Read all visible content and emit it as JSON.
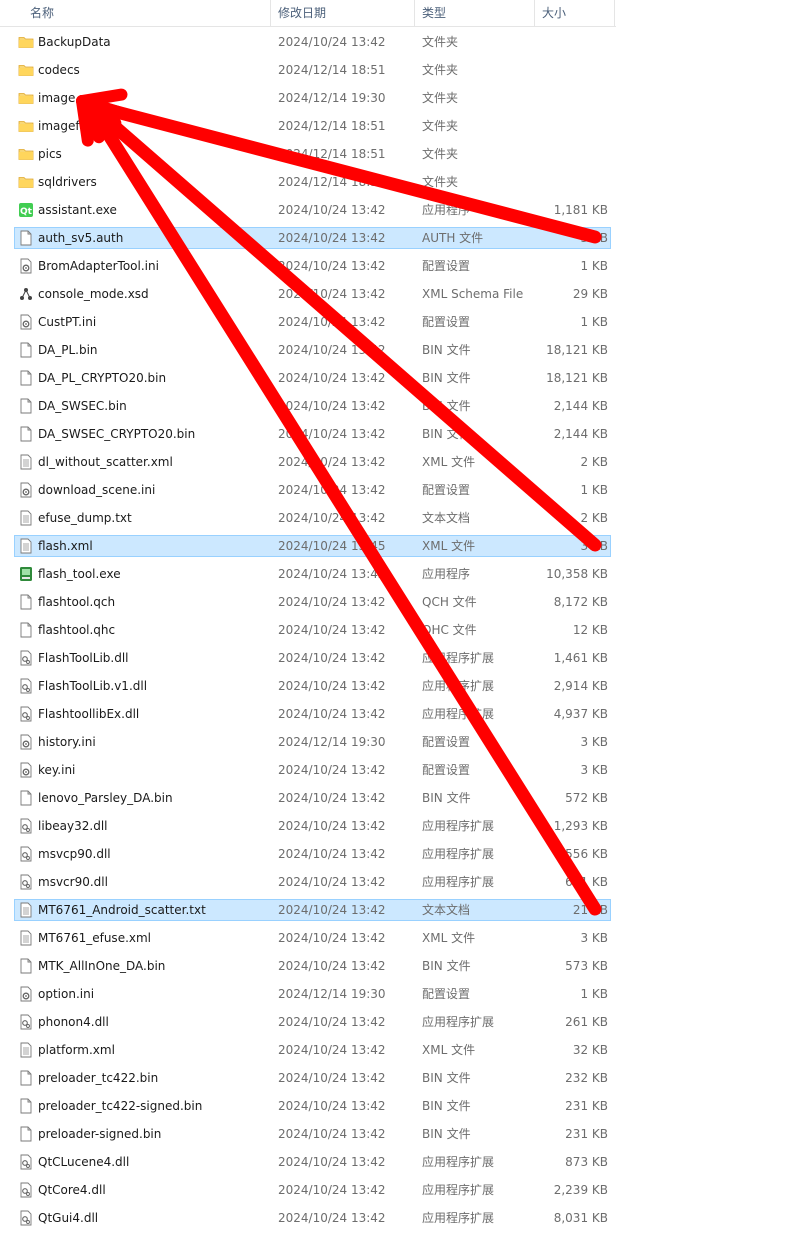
{
  "header": {
    "col_name": "名称",
    "col_date": "修改日期",
    "col_type": "类型",
    "col_size": "大小"
  },
  "rows": [
    {
      "name": "BackupData",
      "date": "2024/10/24 13:42",
      "type": "文件夹",
      "size": "",
      "icon": "folder-icon",
      "sel": false
    },
    {
      "name": "codecs",
      "date": "2024/12/14 18:51",
      "type": "文件夹",
      "size": "",
      "icon": "folder-icon",
      "sel": false
    },
    {
      "name": "image",
      "date": "2024/12/14 19:30",
      "type": "文件夹",
      "size": "",
      "icon": "folder-icon",
      "sel": false
    },
    {
      "name": "imageformats",
      "date": "2024/12/14 18:51",
      "type": "文件夹",
      "size": "",
      "icon": "folder-icon",
      "sel": false
    },
    {
      "name": "pics",
      "date": "2024/12/14 18:51",
      "type": "文件夹",
      "size": "",
      "icon": "folder-icon",
      "sel": false
    },
    {
      "name": "sqldrivers",
      "date": "2024/12/14 18:51",
      "type": "文件夹",
      "size": "",
      "icon": "folder-icon",
      "sel": false
    },
    {
      "name": "assistant.exe",
      "date": "2024/10/24 13:42",
      "type": "应用程序",
      "size": "1,181 KB",
      "icon": "qt-exe-icon",
      "sel": false
    },
    {
      "name": "auth_sv5.auth",
      "date": "2024/10/24 13:42",
      "type": "AUTH 文件",
      "size": "3 KB",
      "icon": "file-icon",
      "sel": true
    },
    {
      "name": "BromAdapterTool.ini",
      "date": "2024/10/24 13:42",
      "type": "配置设置",
      "size": "1 KB",
      "icon": "settings-file-icon",
      "sel": false
    },
    {
      "name": "console_mode.xsd",
      "date": "2024/10/24 13:42",
      "type": "XML Schema File",
      "size": "29 KB",
      "icon": "xsd-icon",
      "sel": false
    },
    {
      "name": "CustPT.ini",
      "date": "2024/10/24 13:42",
      "type": "配置设置",
      "size": "1 KB",
      "icon": "settings-file-icon",
      "sel": false
    },
    {
      "name": "DA_PL.bin",
      "date": "2024/10/24 13:42",
      "type": "BIN 文件",
      "size": "18,121 KB",
      "icon": "file-icon",
      "sel": false
    },
    {
      "name": "DA_PL_CRYPTO20.bin",
      "date": "2024/10/24 13:42",
      "type": "BIN 文件",
      "size": "18,121 KB",
      "icon": "file-icon",
      "sel": false
    },
    {
      "name": "DA_SWSEC.bin",
      "date": "2024/10/24 13:42",
      "type": "BIN 文件",
      "size": "2,144 KB",
      "icon": "file-icon",
      "sel": false
    },
    {
      "name": "DA_SWSEC_CRYPTO20.bin",
      "date": "2024/10/24 13:42",
      "type": "BIN 文件",
      "size": "2,144 KB",
      "icon": "file-icon",
      "sel": false
    },
    {
      "name": "dl_without_scatter.xml",
      "date": "2024/10/24 13:42",
      "type": "XML 文件",
      "size": "2 KB",
      "icon": "text-file-icon",
      "sel": false
    },
    {
      "name": "download_scene.ini",
      "date": "2024/10/24 13:42",
      "type": "配置设置",
      "size": "1 KB",
      "icon": "settings-file-icon",
      "sel": false
    },
    {
      "name": "efuse_dump.txt",
      "date": "2024/10/24 13:42",
      "type": "文本文档",
      "size": "2 KB",
      "icon": "text-file-icon",
      "sel": false
    },
    {
      "name": "flash.xml",
      "date": "2024/10/24 13:45",
      "type": "XML 文件",
      "size": "3 KB",
      "icon": "text-file-icon",
      "sel": true
    },
    {
      "name": "flash_tool.exe",
      "date": "2024/10/24 13:42",
      "type": "应用程序",
      "size": "10,358 KB",
      "icon": "app-exe-icon",
      "sel": false
    },
    {
      "name": "flashtool.qch",
      "date": "2024/10/24 13:42",
      "type": "QCH 文件",
      "size": "8,172 KB",
      "icon": "file-icon",
      "sel": false
    },
    {
      "name": "flashtool.qhc",
      "date": "2024/10/24 13:42",
      "type": "QHC 文件",
      "size": "12 KB",
      "icon": "file-icon",
      "sel": false
    },
    {
      "name": "FlashToolLib.dll",
      "date": "2024/10/24 13:42",
      "type": "应用程序扩展",
      "size": "1,461 KB",
      "icon": "dll-icon",
      "sel": false
    },
    {
      "name": "FlashToolLib.v1.dll",
      "date": "2024/10/24 13:42",
      "type": "应用程序扩展",
      "size": "2,914 KB",
      "icon": "dll-icon",
      "sel": false
    },
    {
      "name": "FlashtoollibEx.dll",
      "date": "2024/10/24 13:42",
      "type": "应用程序扩展",
      "size": "4,937 KB",
      "icon": "dll-icon",
      "sel": false
    },
    {
      "name": "history.ini",
      "date": "2024/12/14 19:30",
      "type": "配置设置",
      "size": "3 KB",
      "icon": "settings-file-icon",
      "sel": false
    },
    {
      "name": "key.ini",
      "date": "2024/10/24 13:42",
      "type": "配置设置",
      "size": "3 KB",
      "icon": "settings-file-icon",
      "sel": false
    },
    {
      "name": "lenovo_Parsley_DA.bin",
      "date": "2024/10/24 13:42",
      "type": "BIN 文件",
      "size": "572 KB",
      "icon": "file-icon",
      "sel": false
    },
    {
      "name": "libeay32.dll",
      "date": "2024/10/24 13:42",
      "type": "应用程序扩展",
      "size": "1,293 KB",
      "icon": "dll-icon",
      "sel": false
    },
    {
      "name": "msvcp90.dll",
      "date": "2024/10/24 13:42",
      "type": "应用程序扩展",
      "size": "556 KB",
      "icon": "dll-icon",
      "sel": false
    },
    {
      "name": "msvcr90.dll",
      "date": "2024/10/24 13:42",
      "type": "应用程序扩展",
      "size": "641 KB",
      "icon": "dll-icon",
      "sel": false
    },
    {
      "name": "MT6761_Android_scatter.txt",
      "date": "2024/10/24 13:42",
      "type": "文本文档",
      "size": "21 KB",
      "icon": "text-file-icon",
      "sel": true
    },
    {
      "name": "MT6761_efuse.xml",
      "date": "2024/10/24 13:42",
      "type": "XML 文件",
      "size": "3 KB",
      "icon": "text-file-icon",
      "sel": false
    },
    {
      "name": "MTK_AllInOne_DA.bin",
      "date": "2024/10/24 13:42",
      "type": "BIN 文件",
      "size": "573 KB",
      "icon": "file-icon",
      "sel": false
    },
    {
      "name": "option.ini",
      "date": "2024/12/14 19:30",
      "type": "配置设置",
      "size": "1 KB",
      "icon": "settings-file-icon",
      "sel": false
    },
    {
      "name": "phonon4.dll",
      "date": "2024/10/24 13:42",
      "type": "应用程序扩展",
      "size": "261 KB",
      "icon": "dll-icon",
      "sel": false
    },
    {
      "name": "platform.xml",
      "date": "2024/10/24 13:42",
      "type": "XML 文件",
      "size": "32 KB",
      "icon": "text-file-icon",
      "sel": false
    },
    {
      "name": "preloader_tc422.bin",
      "date": "2024/10/24 13:42",
      "type": "BIN 文件",
      "size": "232 KB",
      "icon": "file-icon",
      "sel": false
    },
    {
      "name": "preloader_tc422-signed.bin",
      "date": "2024/10/24 13:42",
      "type": "BIN 文件",
      "size": "231 KB",
      "icon": "file-icon",
      "sel": false
    },
    {
      "name": "preloader-signed.bin",
      "date": "2024/10/24 13:42",
      "type": "BIN 文件",
      "size": "231 KB",
      "icon": "file-icon",
      "sel": false
    },
    {
      "name": "QtCLucene4.dll",
      "date": "2024/10/24 13:42",
      "type": "应用程序扩展",
      "size": "873 KB",
      "icon": "dll-icon",
      "sel": false
    },
    {
      "name": "QtCore4.dll",
      "date": "2024/10/24 13:42",
      "type": "应用程序扩展",
      "size": "2,239 KB",
      "icon": "dll-icon",
      "sel": false
    },
    {
      "name": "QtGui4.dll",
      "date": "2024/10/24 13:42",
      "type": "应用程序扩展",
      "size": "8,031 KB",
      "icon": "dll-icon",
      "sel": false
    }
  ],
  "annotation": {
    "arrow_color": "#ff0000",
    "target_row": "image",
    "source_rows": [
      "auth_sv5.auth",
      "flash.xml",
      "MT6761_Android_scatter.txt"
    ]
  }
}
